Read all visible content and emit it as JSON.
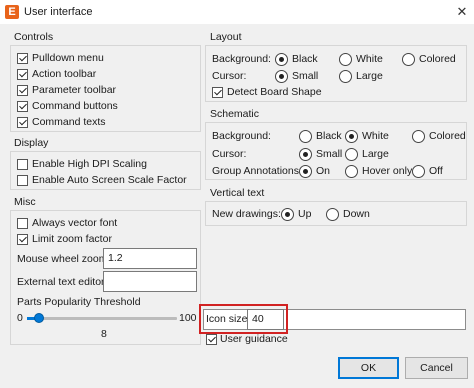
{
  "window": {
    "title": "User interface",
    "app_icon_letter": "E",
    "close_glyph": "✕"
  },
  "controls": {
    "title": "Controls",
    "items": [
      {
        "label": "Pulldown menu",
        "checked": true
      },
      {
        "label": "Action toolbar",
        "checked": true
      },
      {
        "label": "Parameter toolbar",
        "checked": true
      },
      {
        "label": "Command buttons",
        "checked": true
      },
      {
        "label": "Command texts",
        "checked": true
      }
    ]
  },
  "display": {
    "title": "Display",
    "items": [
      {
        "label": "Enable High DPI Scaling",
        "checked": false
      },
      {
        "label": "Enable Auto Screen Scale Factor",
        "checked": false
      }
    ]
  },
  "misc": {
    "title": "Misc",
    "always_vector_font": {
      "label": "Always vector font",
      "checked": false
    },
    "limit_zoom_factor": {
      "label": "Limit zoom factor",
      "checked": true
    },
    "mouse_wheel_zoom": {
      "label": "Mouse wheel zoom",
      "value": "1.2"
    },
    "external_text_editor": {
      "label": "External text editor",
      "value": ""
    },
    "parts_popularity": {
      "label": "Parts Popularity Threshold",
      "min": "0",
      "max": "100",
      "value": "8",
      "fraction": 0.08
    }
  },
  "layout": {
    "title": "Layout",
    "background": {
      "label": "Background:",
      "options": [
        "Black",
        "White",
        "Colored"
      ],
      "selected": "Black"
    },
    "cursor": {
      "label": "Cursor:",
      "options": [
        "Small",
        "Large"
      ],
      "selected": "Small"
    },
    "detect_board_shape": {
      "label": "Detect Board Shape",
      "checked": true
    }
  },
  "schematic": {
    "title": "Schematic",
    "background": {
      "label": "Background:",
      "options": [
        "Black",
        "White",
        "Colored"
      ],
      "selected": "White"
    },
    "cursor": {
      "label": "Cursor:",
      "options": [
        "Small",
        "Large"
      ],
      "selected": "Small"
    },
    "group_annotations": {
      "label": "Group Annotations:",
      "options": [
        "On",
        "Hover only",
        "Off"
      ],
      "selected": "On"
    }
  },
  "vertical_text": {
    "title": "Vertical text",
    "new_drawings": {
      "label": "New drawings:",
      "options": [
        "Up",
        "Down"
      ],
      "selected": "Up"
    }
  },
  "icon_size": {
    "label": "Icon size",
    "value": "40"
  },
  "user_guidance": {
    "label": "User guidance",
    "checked": true
  },
  "buttons": {
    "ok": "OK",
    "cancel": "Cancel"
  },
  "colors": {
    "accent": "#0078d7",
    "highlight": "#d12222",
    "app_icon": "#e8631a"
  }
}
